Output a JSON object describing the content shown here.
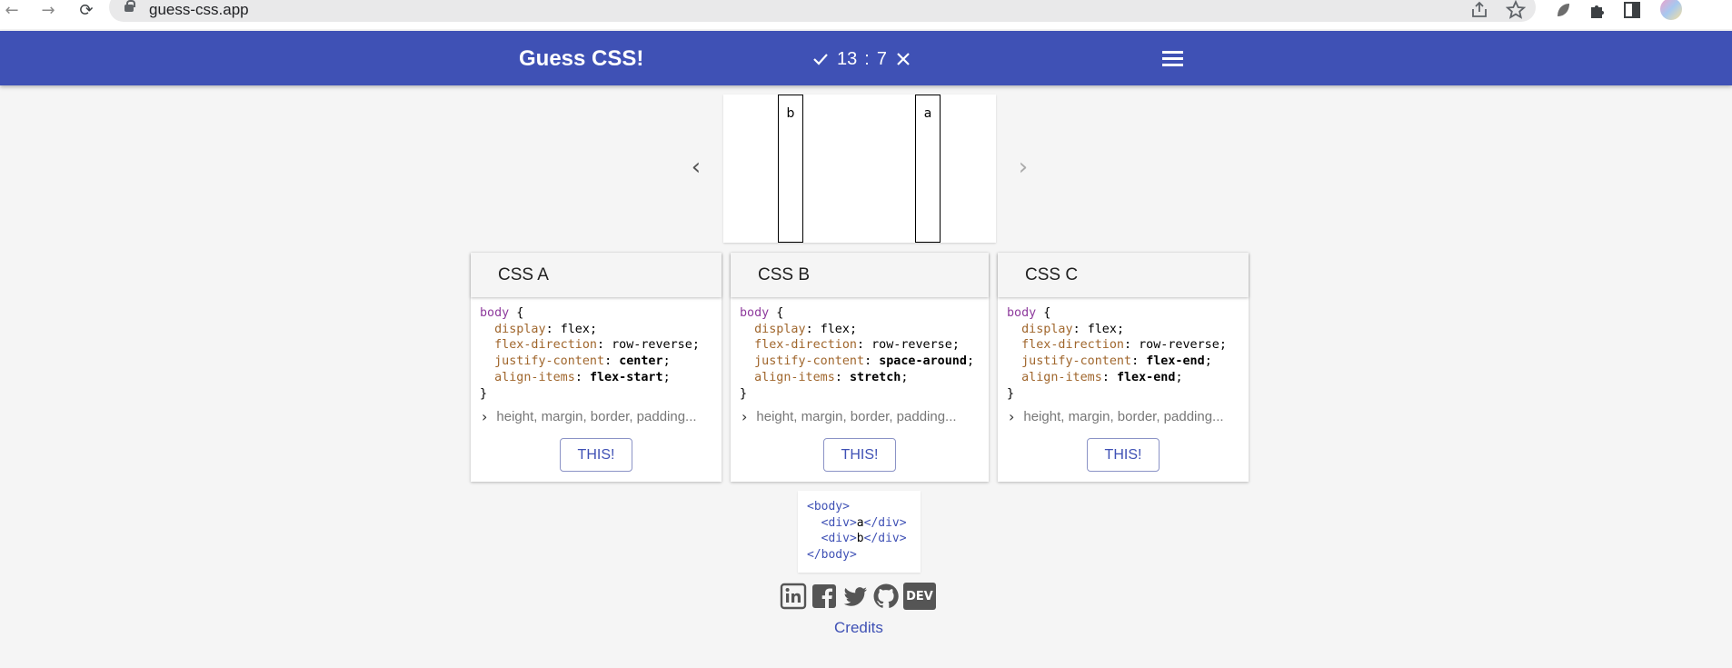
{
  "browser": {
    "url": "guess-css.app"
  },
  "app": {
    "title": "Guess CSS!",
    "score": {
      "correct": "13",
      "separator": ":",
      "wrong": "7"
    }
  },
  "preview": {
    "boxes": [
      {
        "label": "b"
      },
      {
        "label": "a"
      }
    ]
  },
  "cards": [
    {
      "title": "CSS A",
      "selector": "body",
      "rules": [
        {
          "prop": "display",
          "value": "flex",
          "bold": false
        },
        {
          "prop": "flex-direction",
          "value": "row-reverse",
          "bold": false
        },
        {
          "prop": "justify-content",
          "value": "center",
          "bold": true
        },
        {
          "prop": "align-items",
          "value": "flex-start",
          "bold": true
        }
      ],
      "more_label": "height, margin, border, padding...",
      "button_label": "THIS!"
    },
    {
      "title": "CSS B",
      "selector": "body",
      "rules": [
        {
          "prop": "display",
          "value": "flex",
          "bold": false
        },
        {
          "prop": "flex-direction",
          "value": "row-reverse",
          "bold": false
        },
        {
          "prop": "justify-content",
          "value": "space-around",
          "bold": true
        },
        {
          "prop": "align-items",
          "value": "stretch",
          "bold": true
        }
      ],
      "more_label": "height, margin, border, padding...",
      "button_label": "THIS!"
    },
    {
      "title": "CSS C",
      "selector": "body",
      "rules": [
        {
          "prop": "display",
          "value": "flex",
          "bold": false
        },
        {
          "prop": "flex-direction",
          "value": "row-reverse",
          "bold": false
        },
        {
          "prop": "justify-content",
          "value": "flex-end",
          "bold": true
        },
        {
          "prop": "align-items",
          "value": "flex-end",
          "bold": true
        }
      ],
      "more_label": "height, margin, border, padding...",
      "button_label": "THIS!"
    }
  ],
  "html_snippet": {
    "open_body": "<body>",
    "div_open": "<div>",
    "div_close": "</div>",
    "div_a_text": "a",
    "div_b_text": "b",
    "close_body": "</body>"
  },
  "social": [
    {
      "icon": "linkedin-icon"
    },
    {
      "icon": "facebook-icon"
    },
    {
      "icon": "twitter-icon"
    },
    {
      "icon": "github-icon"
    },
    {
      "icon": "dev-icon",
      "text": "DEV"
    }
  ],
  "footer": {
    "credits_label": "Credits"
  }
}
